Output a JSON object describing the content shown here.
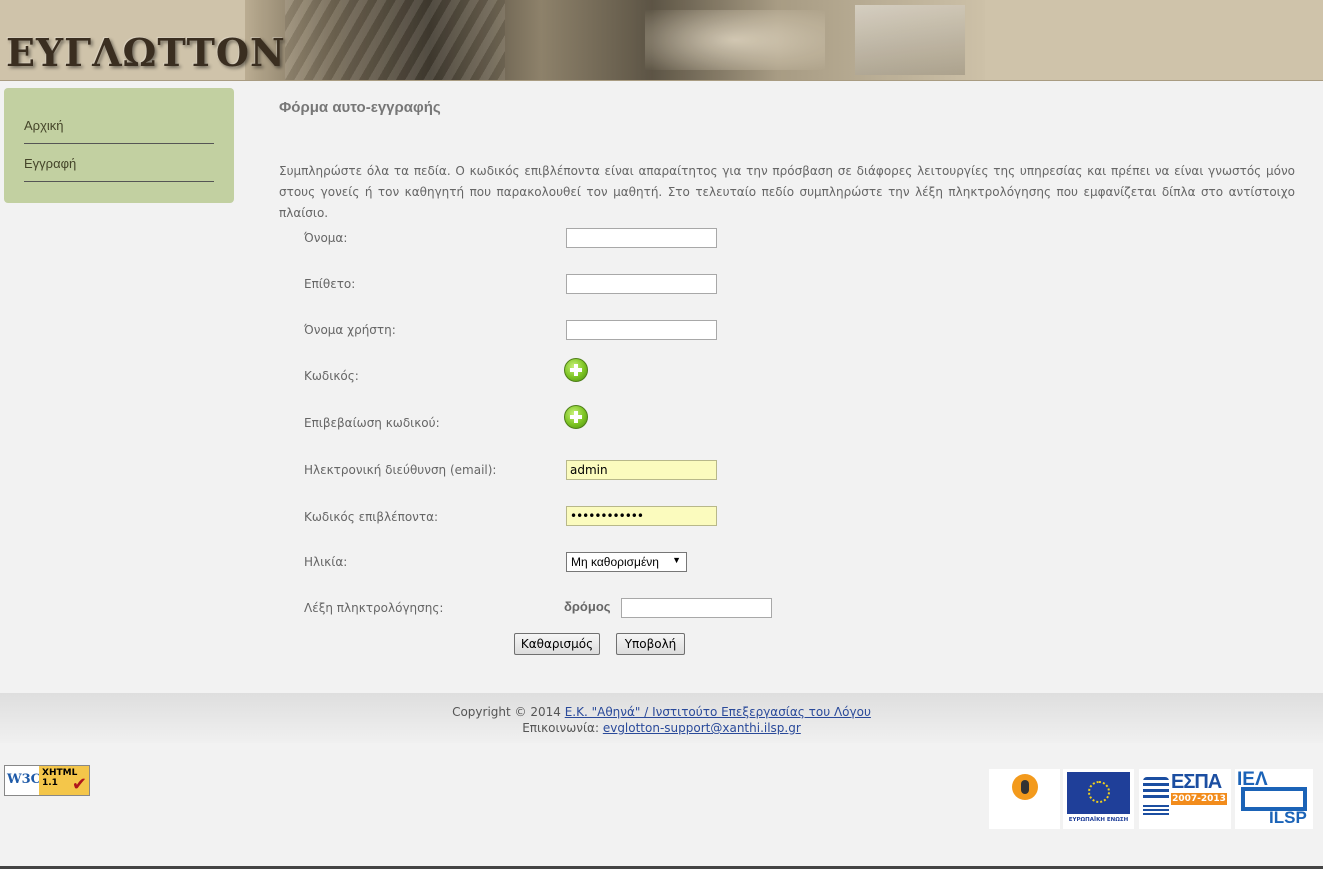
{
  "header": {
    "logo_text": "ΕΥΓΛΩΤΤΟΝ"
  },
  "sidebar": {
    "items": [
      {
        "label": "Αρχική"
      },
      {
        "label": "Εγγραφή"
      }
    ]
  },
  "main": {
    "title": "Φόρμα αυτο-εγγραφής",
    "intro": "Συμπληρώστε όλα τα πεδία. Ο κωδικός επιβλέποντα είναι απαραίτητος για την πρόσβαση σε διάφορες λειτουργίες της υπηρεσίας και πρέπει να είναι γνωστός μόνο στους γονείς ή τον καθηγητή που παρακολουθεί τον μαθητή. Στο τελευταίο πεδίο συμπληρώστε την λέξη πληκτρολόγησης που εμφανίζεται δίπλα στο αντίστοιχο πλαίσιο."
  },
  "form": {
    "first_name": {
      "label": "Όνομα:",
      "value": ""
    },
    "last_name": {
      "label": "Επίθετο:",
      "value": ""
    },
    "username": {
      "label": "Όνομα χρήστη:",
      "value": ""
    },
    "password": {
      "label": "Κωδικός:"
    },
    "password_confirm": {
      "label": "Επιβεβαίωση κωδικού:"
    },
    "email": {
      "label": "Ηλεκτρονική διεύθυνση (email):",
      "value": "admin"
    },
    "supervisor_code": {
      "label": "Κωδικός επιβλέποντα:",
      "value": "••••••••••••"
    },
    "age": {
      "label": "Ηλικία:",
      "selected": "Μη καθορισμένη"
    },
    "captcha": {
      "label": "Λέξη πληκτρολόγησης:",
      "word": "δρόμος",
      "value": ""
    },
    "buttons": {
      "reset": "Καθαρισμός",
      "submit": "Υποβολή"
    }
  },
  "footer": {
    "copyright_prefix": "Copyright © 2014 ",
    "org_link": "Ε.Κ. \"Αθηνά\" / Ινστιτούτο Επεξεργασίας του Λόγου",
    "contact_label": "Επικοινωνία: ",
    "contact_email": "evglotton-support@xanthi.ilsp.gr"
  },
  "badges": {
    "w3c": {
      "w3": "W3C",
      "xhtml": "XHTML",
      "version": "1.1"
    },
    "eu_label": "ΕΥΡΩΠΑΪΚΗ ΕΝΩΣΗ",
    "espa": {
      "name": "ΕΣΠΑ",
      "years": "2007-2013"
    },
    "ilsp": {
      "top": "ΙΕΛ",
      "bottom": "ILSP"
    }
  },
  "colors": {
    "sidebar_bg": "#c2d0a1",
    "filled_field_bg": "#fbfbbe",
    "link": "#2a4a9a"
  }
}
